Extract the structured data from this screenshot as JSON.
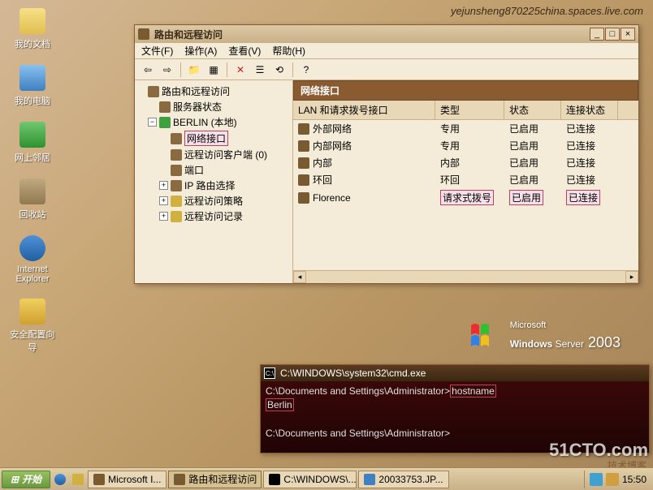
{
  "watermarks": {
    "url": "yejunsheng870225china.spaces.live.com",
    "cto": "51CTO.com",
    "blog": "技术博客"
  },
  "desktop_icons": [
    {
      "label": "我的文档",
      "cls": "di-folder",
      "name": "my-documents-icon"
    },
    {
      "label": "我的电脑",
      "cls": "di-comp",
      "name": "my-computer-icon"
    },
    {
      "label": "网上邻居",
      "cls": "di-net",
      "name": "network-places-icon"
    },
    {
      "label": "回收站",
      "cls": "di-trash",
      "name": "recycle-bin-icon"
    },
    {
      "label": "Internet Explorer",
      "cls": "di-ie",
      "name": "internet-explorer-icon"
    },
    {
      "label": "安全配置向导",
      "cls": "di-sec",
      "name": "security-config-wizard-icon"
    }
  ],
  "rras": {
    "title": "路由和远程访问",
    "menu": {
      "file": "文件(F)",
      "action": "操作(A)",
      "view": "查看(V)",
      "help": "帮助(H)"
    },
    "tree": {
      "root": "路由和远程访问",
      "status": "服务器状态",
      "server": "BERLIN (本地)",
      "net_if": "网络接口",
      "ras_clients": "远程访问客户端 (0)",
      "ports": "端口",
      "ip_route": "IP 路由选择",
      "ras_policy": "远程访问策略",
      "ras_log": "远程访问记录"
    },
    "list": {
      "caption": "网络接口",
      "cols": {
        "c1": "LAN 和请求拨号接口",
        "c2": "类型",
        "c3": "状态",
        "c4": "连接状态"
      },
      "rows": [
        {
          "name": "外部网络",
          "type": "专用",
          "status": "已启用",
          "conn": "已连接"
        },
        {
          "name": "内部网络",
          "type": "专用",
          "status": "已启用",
          "conn": "已连接"
        },
        {
          "name": "内部",
          "type": "内部",
          "status": "已启用",
          "conn": "已连接"
        },
        {
          "name": "环回",
          "type": "环回",
          "status": "已启用",
          "conn": "已连接"
        },
        {
          "name": "Florence",
          "type": "请求式拨号",
          "status": "已启用",
          "conn": "已连接",
          "hl": true
        }
      ]
    }
  },
  "cmd": {
    "title": "C:\\WINDOWS\\system32\\cmd.exe",
    "line1_prompt": "C:\\Documents and Settings\\Administrator>",
    "line1_cmd": "hostname",
    "line2": "Berlin",
    "line3": "C:\\Documents and Settings\\Administrator>"
  },
  "branding": {
    "ms": "Microsoft",
    "win": "Windows",
    "srv": " Server",
    "yr": " 2003"
  },
  "taskbar": {
    "start": "开始",
    "tasks": [
      {
        "label": "Microsoft I...",
        "active": false
      },
      {
        "label": "路由和远程访问",
        "active": true
      },
      {
        "label": "C:\\WINDOWS\\...",
        "active": false
      },
      {
        "label": "20033753.JP...",
        "active": false
      }
    ],
    "clock": "15:50"
  }
}
